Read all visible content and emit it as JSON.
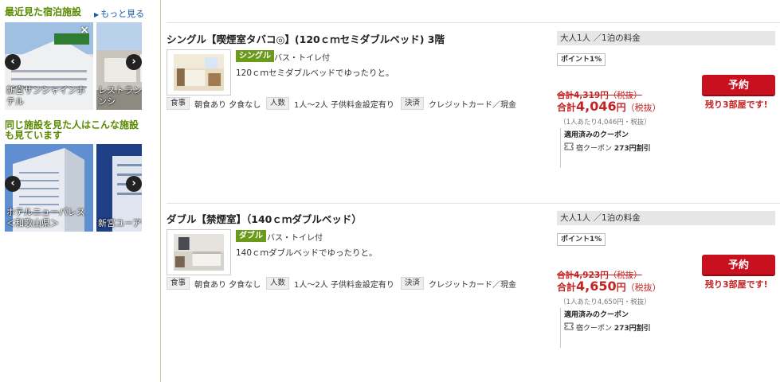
{
  "sidebar": {
    "recent": {
      "title": "最近見た宿泊施設",
      "more_link": "もっと見る",
      "cards": [
        {
          "name": "新宮サンシャインホテル"
        },
        {
          "name": "レストランレイクサンシ"
        }
      ]
    },
    "similar": {
      "title_line1": "同じ施設を見た人はこんな施設",
      "title_line2": "も見ています",
      "cards": [
        {
          "name": "ホテルニューパレス＜和歌山県＞"
        },
        {
          "name": "新宮ユーアーイ"
        }
      ]
    }
  },
  "rooms": [
    {
      "title": "シングル【喫煙室タバコ◎】(120ｃｍセミダブルベッド) 3階",
      "type_badge": "シングル",
      "bath": "バス・トイレ付",
      "description": "120ｃｍセミダブルベッドでゆったりと。",
      "meal_label": "食事",
      "meal_value": "朝食あり 夕食なし",
      "people_label": "人数",
      "people_value": "1人～2人  子供料金設定有り",
      "payment_label": "決済",
      "payment_value": "クレジットカード／現金",
      "price_header": "大人1人 ／1泊の料金",
      "points": "ポイント1%",
      "old_price_label": "合計",
      "old_price_value": "4,319円",
      "old_price_tax": "（税抜）",
      "new_price_label": "合計",
      "new_price_amount": "4,046",
      "new_price_unit": "円",
      "new_price_tax": "（税抜）",
      "per_person": "（1人あたり4,046円・税抜）",
      "coupon_title": "適用済みのクーポン",
      "coupon_prefix": "宿クーポン",
      "coupon_discount": "273円割引",
      "reserve_label": "予約",
      "rooms_left": "残り3部屋です!"
    },
    {
      "title": "ダブル【禁煙室】（140ｃｍダブルベッド）",
      "type_badge": "ダブル",
      "bath": "バス・トイレ付",
      "description": "140ｃｍダブルベッドでゆったりと。",
      "meal_label": "食事",
      "meal_value": "朝食あり 夕食なし",
      "people_label": "人数",
      "people_value": "1人～2人  子供料金設定有り",
      "payment_label": "決済",
      "payment_value": "クレジットカード／現金",
      "price_header": "大人1人 ／1泊の料金",
      "points": "ポイント1%",
      "old_price_label": "合計",
      "old_price_value": "4,923円",
      "old_price_tax": "（税抜）",
      "new_price_label": "合計",
      "new_price_amount": "4,650",
      "new_price_unit": "円",
      "new_price_tax": "（税抜）",
      "per_person": "（1人あたり4,650円・税抜）",
      "coupon_title": "適用済みのクーポン",
      "coupon_prefix": "宿クーポン",
      "coupon_discount": "273円割引",
      "reserve_label": "予約",
      "rooms_left": "残り3部屋です!"
    }
  ],
  "icons": {
    "carousel_prev": "chevron-left-icon",
    "carousel_next": "chevron-right-icon",
    "close": "close-icon",
    "more": "triangle-right-icon",
    "coupon": "ticket-icon"
  },
  "colors": {
    "section_title": "#5a8a00",
    "link": "#1a5ca8",
    "badge": "#6c9b1b",
    "price_red": "#c42323",
    "reserve_button": "#c8101e"
  }
}
